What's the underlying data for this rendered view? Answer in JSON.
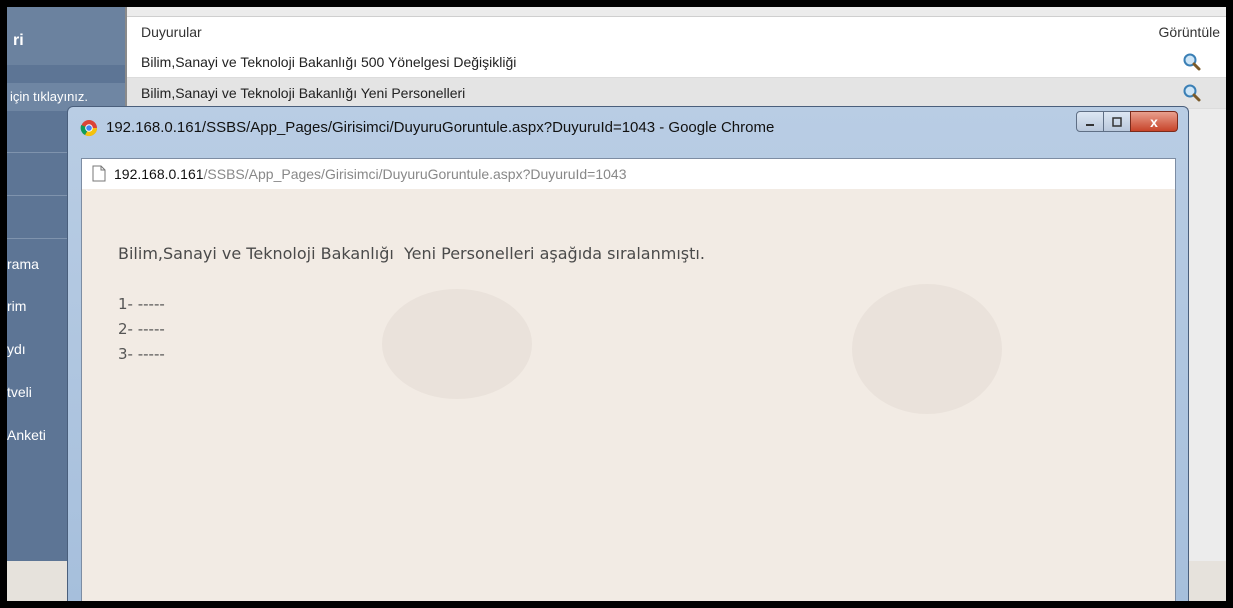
{
  "sidebar": {
    "items": [
      {
        "label": "ri"
      },
      {
        "label": "için tıklayınız."
      },
      {
        "label": "rama"
      },
      {
        "label": "rim"
      },
      {
        "label": "ydı"
      },
      {
        "label": "tveli"
      },
      {
        "label": "Anketi"
      }
    ]
  },
  "table": {
    "header_title": "Duyurular",
    "header_action": "Görüntüle",
    "rows": [
      {
        "title": "Bilim,Sanayi ve Teknoloji Bakanlığı 500 Yönelgesi Değişikliği"
      },
      {
        "title": "Bilim,Sanayi ve Teknoloji Bakanlığı Yeni Personelleri"
      }
    ]
  },
  "popup": {
    "window_title": "192.168.0.161/SSBS/App_Pages/Girisimci/DuyuruGoruntule.aspx?DuyuruId=1043 - Google Chrome",
    "address_host": "192.168.0.161",
    "address_path": "/SSBS/App_Pages/Girisimci/DuyuruGoruntule.aspx?DuyuruId=1043",
    "message": "Bilim,Sanayi ve Teknoloji Bakanlığı  Yeni Personelleri aşağıda sıralanmıştı.",
    "list": [
      "1- -----",
      "2- -----",
      "3- -----"
    ],
    "close_glyph": "x"
  },
  "colors": {
    "sidebar": "#5d7595",
    "popup_frame": "#a6bfdc",
    "content_bg": "#f2ebe4",
    "close_button": "#c7442a"
  },
  "icons": [
    "chrome-logo-icon",
    "document-icon",
    "magnifier-icon",
    "minimize-icon",
    "maximize-icon",
    "close-icon"
  ]
}
